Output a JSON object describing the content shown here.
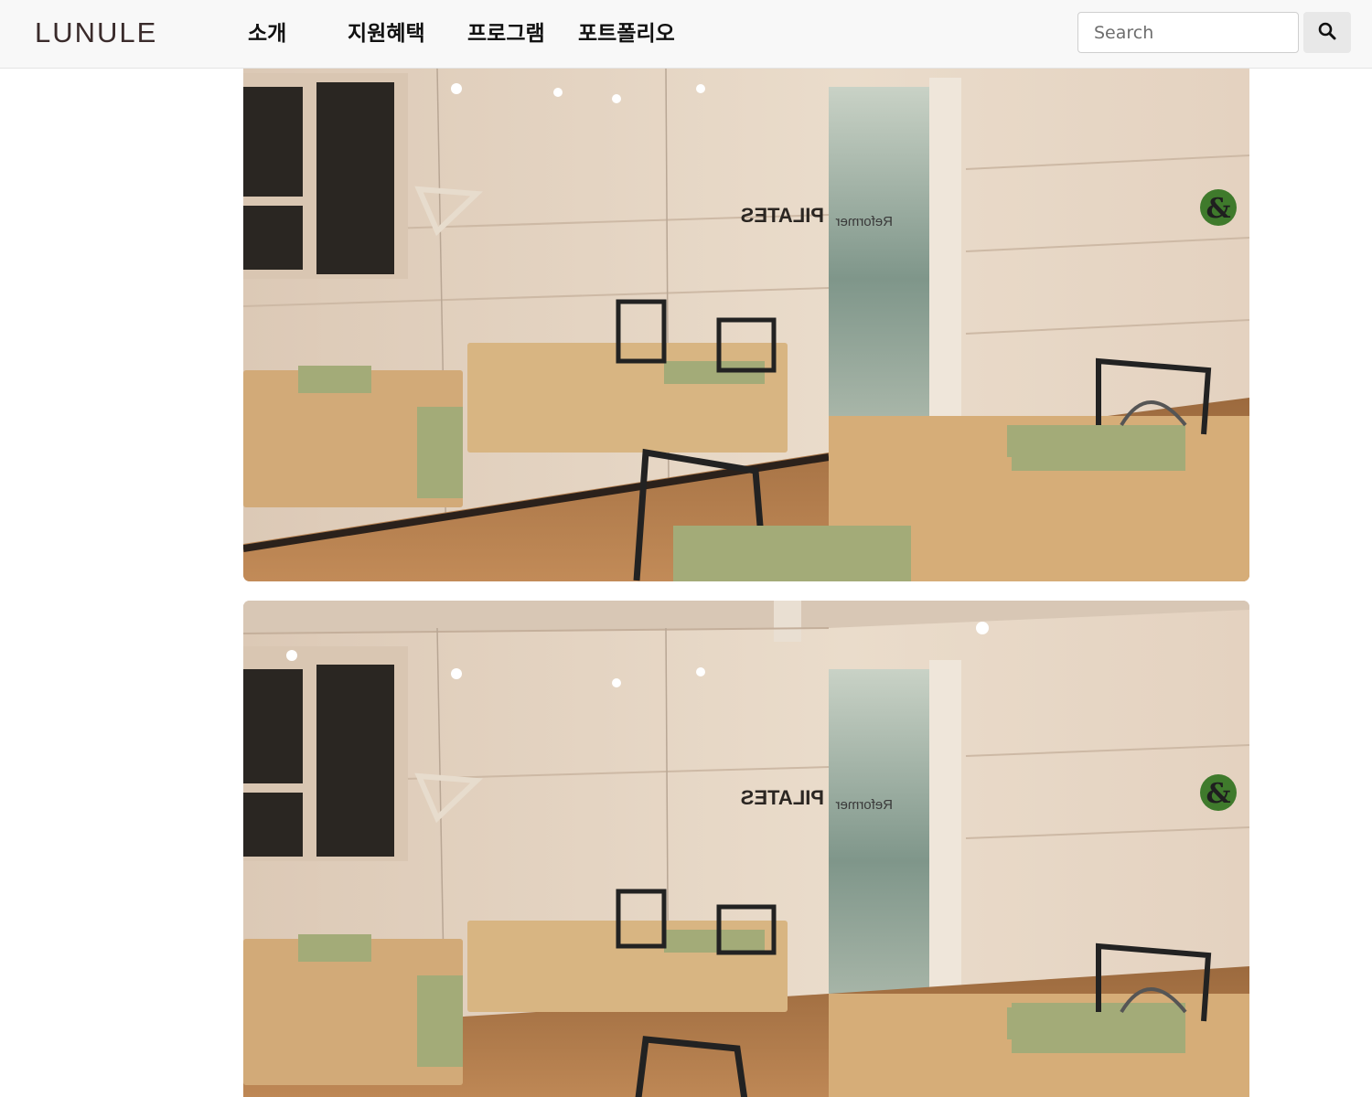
{
  "brand": {
    "logo_text": "LUNULE"
  },
  "nav": {
    "items": [
      {
        "label": "소개"
      },
      {
        "label": "지원혜택"
      },
      {
        "label": "프로그램"
      },
      {
        "label": "포트폴리오"
      }
    ]
  },
  "search": {
    "placeholder": "Search",
    "value": "",
    "button_icon": "search-icon"
  },
  "gallery": {
    "photos": [
      {
        "sign_text": "PILATES",
        "door_text": "Reformer",
        "badge_text": "&"
      },
      {
        "sign_text": "PILATES",
        "door_text": "Reformer",
        "badge_text": "&"
      }
    ]
  },
  "colors": {
    "navbar_bg": "#f8f8f8",
    "brand": "#3a2b2b",
    "badge_green": "#3f7a2c",
    "wall": "#e6d6c4",
    "floor": "#b07a4c",
    "reformer_pad": "#a3ab78"
  }
}
